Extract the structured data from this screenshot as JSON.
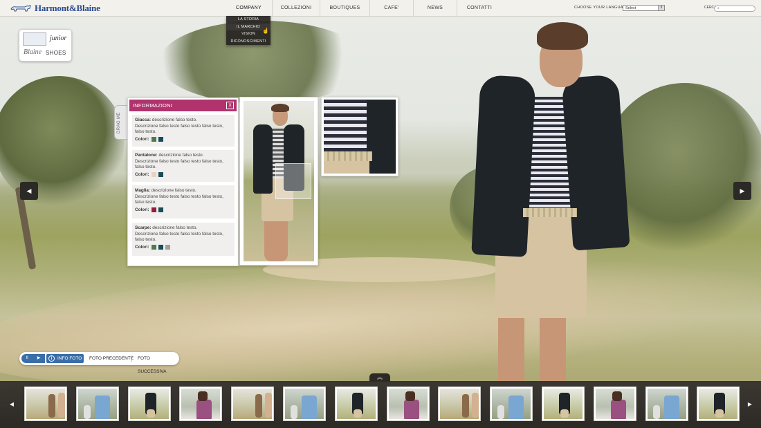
{
  "brand": {
    "name": "Harmont&Blaine",
    "junior": "junior",
    "script": "Blaine",
    "shoes": "SHOES"
  },
  "nav": [
    {
      "label": "COMPANY",
      "active": true
    },
    {
      "label": "COLLEZIONI"
    },
    {
      "label": "BOUTIQUES"
    },
    {
      "label": "CAFE'"
    },
    {
      "label": "NEWS"
    },
    {
      "label": "CONTATTI"
    }
  ],
  "company_menu": [
    "LA STORIA",
    "IL MARCHIO",
    "VISION",
    "RICONOSCIMENTI"
  ],
  "language": {
    "label": "CHOOSE YOUR LANGUAGE",
    "selected": "Select"
  },
  "search": {
    "label": "CERCA"
  },
  "drag_label": "DRAG ME",
  "info": {
    "title": "INFORMAZIONI",
    "close": "X",
    "items": [
      {
        "name": "Giacca:",
        "desc": "descrizione  falso testo.",
        "long": "Descrizione falso testo falso testo falso testo, falso testo.",
        "colors_label": "Colori:",
        "colors": [
          "#4c7a4c",
          "#1b4a5a"
        ]
      },
      {
        "name": "Pantalone:",
        "desc": "descrizione  falso testo.",
        "long": "Descrizione falso testo falso testo falso testo, falso testo.",
        "colors_label": "Colori:",
        "colors": [
          "#e8d2c0",
          "#1b4a5a"
        ]
      },
      {
        "name": "Maglia:",
        "desc": "descrizione  falso testo.",
        "long": "Descrizione falso testo falso testo falso testo, falso testo.",
        "colors_label": "Colori:",
        "colors": [
          "#9a1a3a",
          "#1b4a5a"
        ]
      },
      {
        "name": "Scarpe:",
        "desc": "descrizione  falso testo.",
        "long": "Descrizione falso testo falso testo falso testo, falso testo.",
        "colors_label": "Colori:",
        "colors": [
          "#4c7a4c",
          "#1b4a5a",
          "#a0a09a"
        ]
      }
    ]
  },
  "controls": {
    "pause": "II",
    "play": "▶",
    "info_icon": "i",
    "info_label": "INFO FOTO",
    "prev_label": "FOTO PRECEDENTE",
    "next_label": "FOTO SUCCESSIVA"
  },
  "icons": {
    "left_arrow": "◀",
    "right_arrow": "▶",
    "strip_handle": "︽"
  },
  "thumbnails": [
    "couple",
    "man-blue",
    "man-jacket",
    "woman-pink",
    "couple",
    "man-blue",
    "man-jacket",
    "woman-pink",
    "couple",
    "man-blue",
    "man-jacket",
    "woman-pink",
    "man-blue",
    "man-jacket"
  ]
}
